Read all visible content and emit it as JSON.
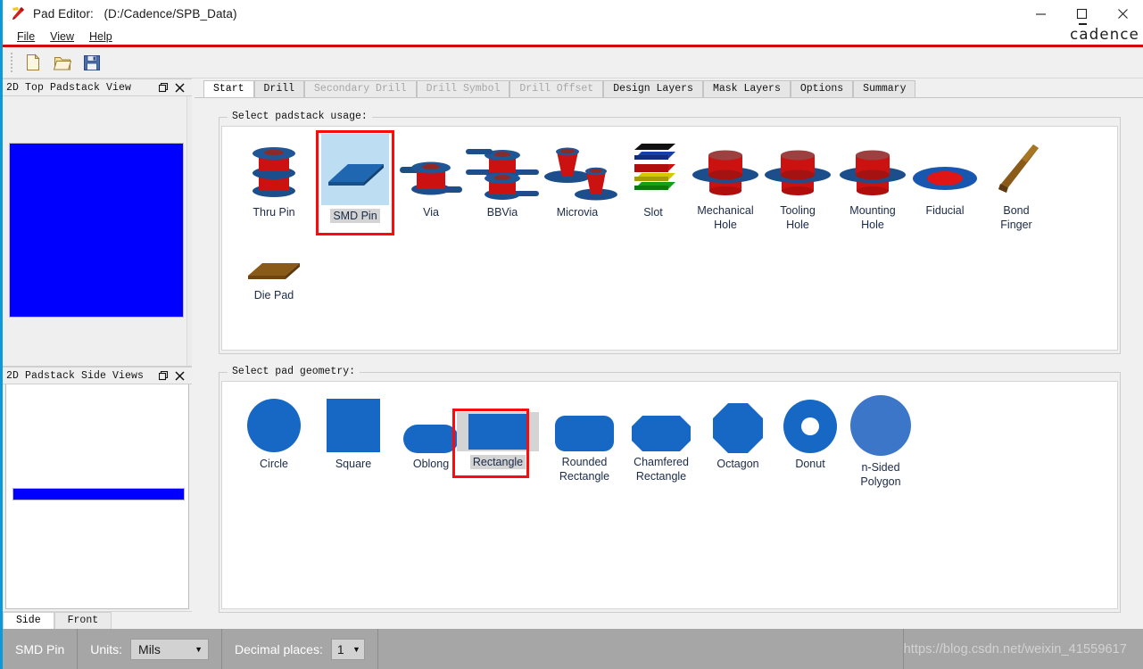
{
  "window": {
    "title": "Pad Editor:   (D:/Cadence/SPB_Data)",
    "app_icon": "pad-editor-icon",
    "brand": "cadence",
    "minimize": "minimize-icon",
    "maximize": "maximize-icon",
    "close": "close-icon"
  },
  "menu": {
    "items": [
      {
        "label": "File",
        "mnemonic": "F"
      },
      {
        "label": "View",
        "mnemonic": "V"
      },
      {
        "label": "Help",
        "mnemonic": "H"
      }
    ]
  },
  "toolbar": {
    "buttons": [
      {
        "name": "new-file-button",
        "icon": "new-document-icon"
      },
      {
        "name": "open-file-button",
        "icon": "open-folder-icon"
      },
      {
        "name": "save-file-button",
        "icon": "save-floppy-icon"
      }
    ]
  },
  "dock": {
    "panels": [
      {
        "title": "2D Top Padstack View",
        "float_icon": "restore-icon",
        "close_icon": "close-icon",
        "pad_color": "#0000ff",
        "pad_shape": "square"
      },
      {
        "title": "2D Padstack Side Views",
        "float_icon": "restore-icon",
        "close_icon": "close-icon",
        "pad_color": "#0000ff",
        "pad_shape": "bar"
      }
    ],
    "view_tabs": [
      {
        "label": "Side",
        "active": true
      },
      {
        "label": "Front",
        "active": false
      }
    ]
  },
  "main": {
    "tabs": [
      {
        "label": "Start",
        "active": true,
        "disabled": false
      },
      {
        "label": "Drill",
        "active": false,
        "disabled": false
      },
      {
        "label": "Secondary Drill",
        "active": false,
        "disabled": true
      },
      {
        "label": "Drill Symbol",
        "active": false,
        "disabled": true
      },
      {
        "label": "Drill Offset",
        "active": false,
        "disabled": true
      },
      {
        "label": "Design Layers",
        "active": false,
        "disabled": false
      },
      {
        "label": "Mask Layers",
        "active": false,
        "disabled": false
      },
      {
        "label": "Options",
        "active": false,
        "disabled": false
      },
      {
        "label": "Summary",
        "active": false,
        "disabled": false
      }
    ],
    "padstack_usage": {
      "legend": "Select padstack usage:",
      "selected": "SMD Pin",
      "items": [
        {
          "label": "Thru Pin",
          "icon": "thru-pin-icon"
        },
        {
          "label": "SMD Pin",
          "icon": "smd-pin-icon"
        },
        {
          "label": "Via",
          "icon": "via-icon"
        },
        {
          "label": "BBVia",
          "icon": "bbvia-icon"
        },
        {
          "label": "Microvia",
          "icon": "microvia-icon"
        },
        {
          "label": "Slot",
          "icon": "slot-icon"
        },
        {
          "label": "Mechanical\nHole",
          "icon": "mechanical-hole-icon"
        },
        {
          "label": "Tooling\nHole",
          "icon": "tooling-hole-icon"
        },
        {
          "label": "Mounting\nHole",
          "icon": "mounting-hole-icon"
        },
        {
          "label": "Fiducial",
          "icon": "fiducial-icon"
        },
        {
          "label": "Bond\nFinger",
          "icon": "bond-finger-icon"
        },
        {
          "label": "Die Pad",
          "icon": "die-pad-icon"
        }
      ]
    },
    "pad_geometry": {
      "legend": "Select pad geometry:",
      "selected": "Rectangle",
      "items": [
        {
          "label": "Circle",
          "icon": "circle-shape-icon"
        },
        {
          "label": "Square",
          "icon": "square-shape-icon"
        },
        {
          "label": "Oblong",
          "icon": "oblong-shape-icon"
        },
        {
          "label": "Rectangle",
          "icon": "rectangle-shape-icon"
        },
        {
          "label": "Rounded\nRectangle",
          "icon": "rounded-rectangle-shape-icon"
        },
        {
          "label": "Chamfered\nRectangle",
          "icon": "chamfered-rectangle-shape-icon"
        },
        {
          "label": "Octagon",
          "icon": "octagon-shape-icon"
        },
        {
          "label": "Donut",
          "icon": "donut-shape-icon"
        },
        {
          "label": "n-Sided\nPolygon",
          "icon": "n-sided-polygon-shape-icon"
        }
      ]
    }
  },
  "statusbar": {
    "padstack_type": "SMD Pin",
    "units_label": "Units:",
    "units_value": "Mils",
    "decimal_label": "Decimal places:",
    "decimal_value": "1",
    "watermark": "https://blog.csdn.net/weixin_41559617"
  },
  "colors": {
    "brand_red": "#cf0a0a",
    "selection_red": "#fb0b0b",
    "pad_blue": "#0000ff",
    "shape_blue": "#1668c4",
    "accent_cyan": "#0b9ad6"
  }
}
